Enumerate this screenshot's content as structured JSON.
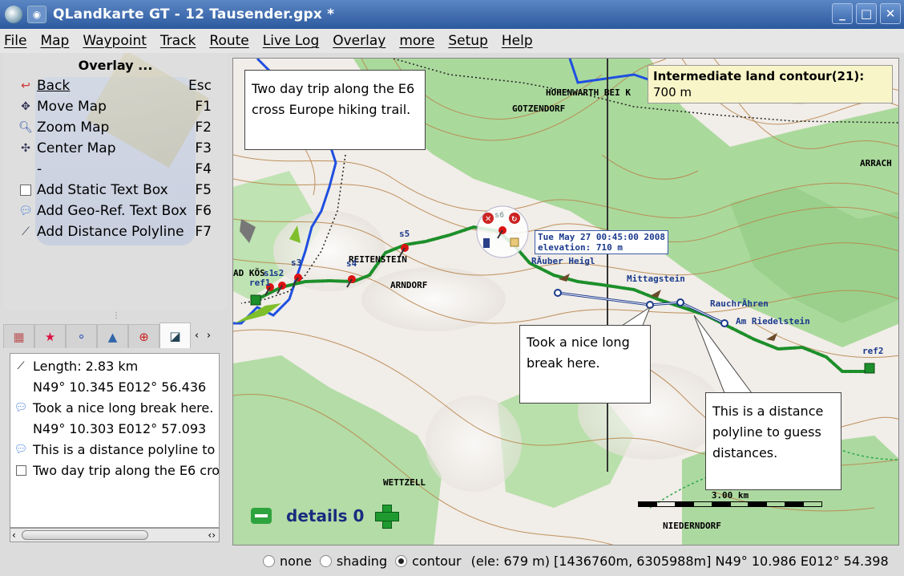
{
  "window": {
    "title": "QLandkarte GT - 12 Tausender.gpx *",
    "buttons": {
      "minimize": "_",
      "maximize": "□",
      "close": "✕"
    }
  },
  "menu": [
    "File",
    "Map",
    "Waypoint",
    "Track",
    "Route",
    "Live Log",
    "Overlay",
    "more",
    "Setup",
    "Help"
  ],
  "overlay_panel": {
    "title": "Overlay ...",
    "options": [
      {
        "label": "Back",
        "key": "Esc",
        "icon": "back-arrow-icon"
      },
      {
        "label": "Move Map",
        "key": "F1",
        "icon": "move-icon"
      },
      {
        "label": "Zoom Map",
        "key": "F2",
        "icon": "zoom-icon"
      },
      {
        "label": "Center Map",
        "key": "F3",
        "icon": "center-icon"
      },
      {
        "label": "-",
        "key": "F4",
        "icon": ""
      },
      {
        "label": "Add Static Text Box",
        "key": "F5",
        "icon": "textbox-icon"
      },
      {
        "label": "Add Geo-Ref. Text Box",
        "key": "F6",
        "icon": "speech-bubble-icon"
      },
      {
        "label": "Add Distance Polyline",
        "key": "F7",
        "icon": "polyline-icon"
      }
    ]
  },
  "tabs": [
    "map-tab",
    "waypoint-tab",
    "route-tab",
    "track-tab",
    "lifebuoy-tab",
    "overlay-tab"
  ],
  "overlay_list": [
    {
      "icon": "polyline-icon",
      "text": "Length: 2.83 km"
    },
    {
      "icon": "",
      "text": "N49° 10.345 E012° 56.436"
    },
    {
      "icon": "speech-bubble-icon",
      "text": "Took a nice long break here."
    },
    {
      "icon": "",
      "text": "N49° 10.303 E012° 57.093"
    },
    {
      "icon": "speech-bubble-icon",
      "text": "This is a distance polyline to"
    },
    {
      "icon": "textbox-icon",
      "text": "Two day trip along the E6 cro"
    }
  ],
  "map": {
    "tooltip": {
      "title": "Intermediate land contour(21):",
      "value": "700 m"
    },
    "bubbles": {
      "trip": "Two day trip along the E6 cross Europe hiking trail.",
      "break": "Took a nice long break here.",
      "polyline": "This is a distance polyline to guess distances."
    },
    "towns": [
      "HOHENWARTH BEI K",
      "GOTZENDORF",
      "ARRACH",
      "REITENSTEIN",
      "ARNDORF",
      "WETTZELL",
      "NIEDERNDORF",
      "AD KÖS"
    ],
    "waypoints": [
      "s5",
      "s3",
      "s4",
      "s2",
      "s1",
      "ref1",
      "s6",
      "ref2",
      "RÄuber Heigl",
      "Mittagstein",
      "RauchrÄhren",
      "Am Riedelstein"
    ],
    "infobox": {
      "line1": "Tue May 27 00:45:00 2008",
      "line2": "elevation: 710 m"
    },
    "details": "details 0",
    "scale": "3.00 km"
  },
  "status": {
    "options": [
      "none",
      "shading",
      "contour"
    ],
    "selected": "contour",
    "info": "(ele: 679 m) [1436760m, 6305988m] N49° 10.986 E012° 54.398"
  },
  "colors": {
    "track": "#1f8f2a",
    "forest": "#a8d89a",
    "contour": "#b8874d",
    "route_line": "#1a3a8c",
    "river": "#1f4fe0"
  }
}
